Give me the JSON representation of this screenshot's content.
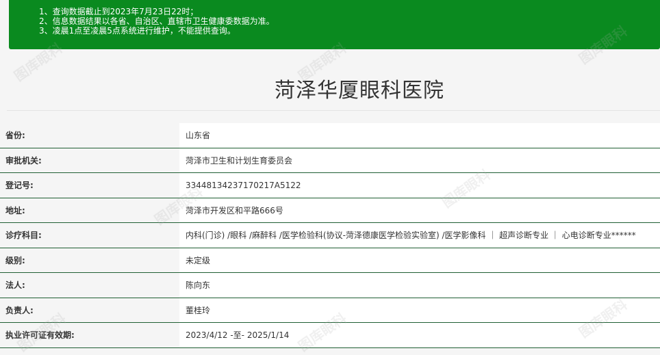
{
  "notice": {
    "lines": [
      "1、查询数据截止到2023年7月23日22时；",
      "2、信息数据结果以各省、自治区、直辖市卫生健康委数据为准。",
      "3、凌晨1点至凌晨5点系统进行维护，不能提供查询。"
    ]
  },
  "page_title": "菏泽华厦眼科医院",
  "watermark_text": "图库眼科",
  "table": {
    "rows": [
      {
        "label": "省份:",
        "value": "山东省"
      },
      {
        "label": "审批机关:",
        "value": "菏泽市卫生和计划生育委员会"
      },
      {
        "label": "登记号:",
        "value": "33448134237170217A5122"
      },
      {
        "label": "地址:",
        "value": "菏泽市开发区和平路666号"
      },
      {
        "label": "诊疗科目:",
        "value": "内科(门诊) /眼科 /麻醉科 /医学检验科(协议-菏泽德康医学检验实验室) /医学影像科 ｜ 超声诊断专业 ｜ 心电诊断专业******"
      },
      {
        "label": "级别:",
        "value": "未定级"
      },
      {
        "label": "法人:",
        "value": "陈向东"
      },
      {
        "label": "负责人:",
        "value": "董桂玲"
      },
      {
        "label": "执业许可证有效期:",
        "value": "2023/4/12 -至- 2025/1/14"
      }
    ]
  }
}
